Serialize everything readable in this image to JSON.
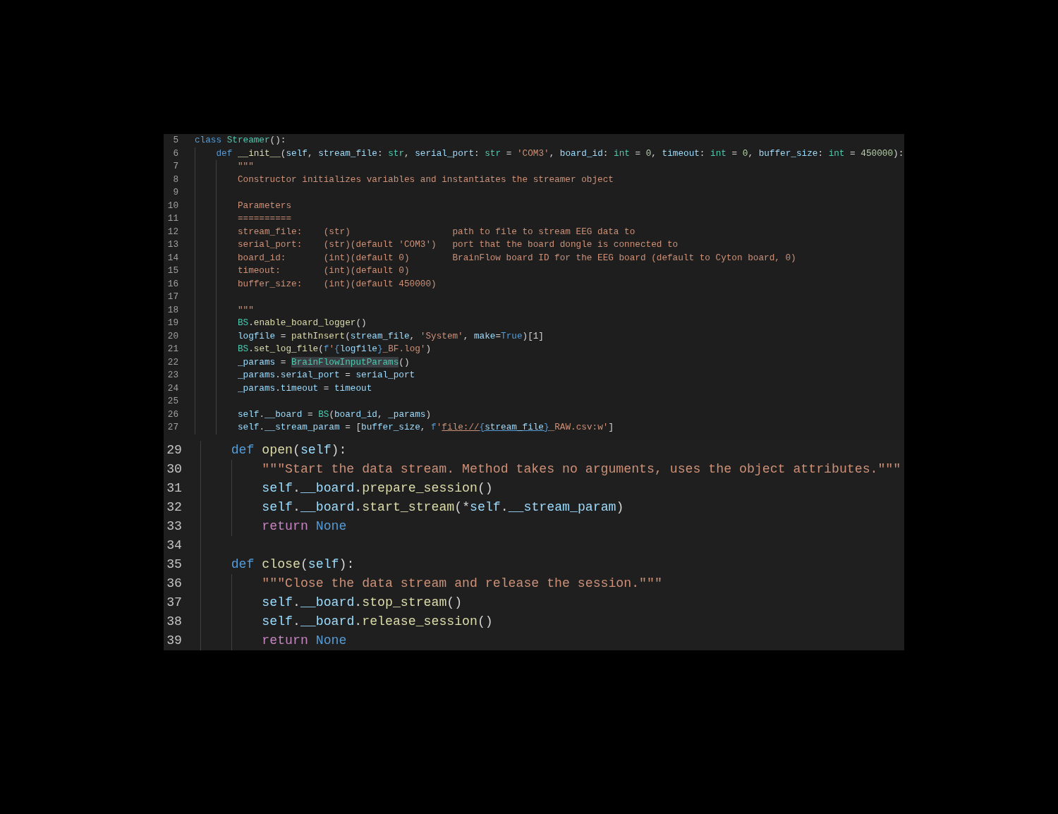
{
  "panels": [
    {
      "lines": [
        {
          "number": "5",
          "tokens": [
            {
              "text": "class ",
              "kind": "keyword"
            },
            {
              "text": "Streamer",
              "kind": "type"
            },
            {
              "text": "():",
              "kind": "plain"
            }
          ],
          "children": [
            {
              "number": "6",
              "tokens": [
                {
                  "text": "def ",
                  "kind": "keyword"
                },
                {
                  "text": "__init__",
                  "kind": "func"
                },
                {
                  "text": "(",
                  "kind": "plain"
                },
                {
                  "text": "self",
                  "kind": "var"
                },
                {
                  "text": ", ",
                  "kind": "plain"
                },
                {
                  "text": "stream_file",
                  "kind": "var"
                },
                {
                  "text": ": ",
                  "kind": "plain"
                },
                {
                  "text": "str",
                  "kind": "type"
                },
                {
                  "text": ", ",
                  "kind": "plain"
                },
                {
                  "text": "serial_port",
                  "kind": "var"
                },
                {
                  "text": ": ",
                  "kind": "plain"
                },
                {
                  "text": "str",
                  "kind": "type"
                },
                {
                  "text": " = ",
                  "kind": "plain"
                },
                {
                  "text": "'COM3'",
                  "kind": "string"
                },
                {
                  "text": ", ",
                  "kind": "plain"
                },
                {
                  "text": "board_id",
                  "kind": "var"
                },
                {
                  "text": ": ",
                  "kind": "plain"
                },
                {
                  "text": "int",
                  "kind": "type"
                },
                {
                  "text": " = ",
                  "kind": "plain"
                },
                {
                  "text": "0",
                  "kind": "number"
                },
                {
                  "text": ", ",
                  "kind": "plain"
                },
                {
                  "text": "timeout",
                  "kind": "var"
                },
                {
                  "text": ": ",
                  "kind": "plain"
                },
                {
                  "text": "int",
                  "kind": "type"
                },
                {
                  "text": " = ",
                  "kind": "plain"
                },
                {
                  "text": "0",
                  "kind": "number"
                },
                {
                  "text": ", ",
                  "kind": "plain"
                },
                {
                  "text": "buffer_size",
                  "kind": "var"
                },
                {
                  "text": ": ",
                  "kind": "plain"
                },
                {
                  "text": "int",
                  "kind": "type"
                },
                {
                  "text": " = ",
                  "kind": "plain"
                },
                {
                  "text": "450000",
                  "kind": "number"
                },
                {
                  "text": "):",
                  "kind": "plain"
                }
              ],
              "children": [
                {
                  "number": "7",
                  "tokens": [
                    {
                      "text": "\"\"\"",
                      "kind": "string"
                    }
                  ]
                },
                {
                  "number": "8",
                  "tokens": [
                    {
                      "text": "Constructor initializes variables and instantiates the streamer object",
                      "kind": "string"
                    }
                  ]
                },
                {
                  "number": "9"
                },
                {
                  "number": "10",
                  "tokens": [
                    {
                      "text": "Parameters",
                      "kind": "string"
                    }
                  ]
                },
                {
                  "number": "11",
                  "tokens": [
                    {
                      "text": "==========",
                      "kind": "string"
                    }
                  ]
                },
                {
                  "number": "12",
                  "tokens": [
                    {
                      "text": "stream_file:    (str)                   path to file to stream EEG data to",
                      "kind": "string"
                    }
                  ]
                },
                {
                  "number": "13",
                  "tokens": [
                    {
                      "text": "serial_port:    (str)(default 'COM3')   port that the board dongle is connected to",
                      "kind": "string"
                    }
                  ]
                },
                {
                  "number": "14",
                  "tokens": [
                    {
                      "text": "board_id:       (int)(default 0)        BrainFlow board ID for the EEG board (default to Cyton board, 0)",
                      "kind": "string"
                    }
                  ]
                },
                {
                  "number": "15",
                  "tokens": [
                    {
                      "text": "timeout:        (int)(default 0)",
                      "kind": "string"
                    }
                  ]
                },
                {
                  "number": "16",
                  "tokens": [
                    {
                      "text": "buffer_size:    (int)(default 450000)",
                      "kind": "string"
                    }
                  ]
                },
                {
                  "number": "17"
                },
                {
                  "number": "18",
                  "tokens": [
                    {
                      "text": "\"\"\"",
                      "kind": "string"
                    }
                  ]
                },
                {
                  "number": "19",
                  "tokens": [
                    {
                      "text": "BS",
                      "kind": "type"
                    },
                    {
                      "text": ".",
                      "kind": "plain"
                    },
                    {
                      "text": "enable_board_logger",
                      "kind": "func"
                    },
                    {
                      "text": "()",
                      "kind": "plain"
                    }
                  ]
                },
                {
                  "number": "20",
                  "tokens": [
                    {
                      "text": "logfile",
                      "kind": "var"
                    },
                    {
                      "text": " = ",
                      "kind": "plain"
                    },
                    {
                      "text": "pathInsert",
                      "kind": "func"
                    },
                    {
                      "text": "(",
                      "kind": "plain"
                    },
                    {
                      "text": "stream_file",
                      "kind": "var"
                    },
                    {
                      "text": ", ",
                      "kind": "plain"
                    },
                    {
                      "text": "'System'",
                      "kind": "string"
                    },
                    {
                      "text": ", ",
                      "kind": "plain"
                    },
                    {
                      "text": "make",
                      "kind": "var"
                    },
                    {
                      "text": "=",
                      "kind": "plain"
                    },
                    {
                      "text": "True",
                      "kind": "constant"
                    },
                    {
                      "text": ")[1]",
                      "kind": "plain"
                    }
                  ]
                },
                {
                  "number": "21",
                  "tokens": [
                    {
                      "text": "BS",
                      "kind": "type"
                    },
                    {
                      "text": ".",
                      "kind": "plain"
                    },
                    {
                      "text": "set_log_file",
                      "kind": "func"
                    },
                    {
                      "text": "(",
                      "kind": "plain"
                    },
                    {
                      "text": "f",
                      "kind": "constant"
                    },
                    {
                      "text": "'",
                      "kind": "string"
                    },
                    {
                      "text": "{",
                      "kind": "constant"
                    },
                    {
                      "text": "logfile",
                      "kind": "var"
                    },
                    {
                      "text": "}",
                      "kind": "constant"
                    },
                    {
                      "text": "_BF.log'",
                      "kind": "string"
                    },
                    {
                      "text": ")",
                      "kind": "plain"
                    }
                  ]
                },
                {
                  "number": "22",
                  "tokens": [
                    {
                      "text": "_params",
                      "kind": "var"
                    },
                    {
                      "text": " = ",
                      "kind": "plain"
                    },
                    {
                      "text": "BrainFlowInputParams",
                      "kind": "match"
                    },
                    {
                      "text": "()",
                      "kind": "plain"
                    }
                  ]
                },
                {
                  "number": "23",
                  "tokens": [
                    {
                      "text": "_params",
                      "kind": "var"
                    },
                    {
                      "text": ".",
                      "kind": "plain"
                    },
                    {
                      "text": "serial_port",
                      "kind": "var"
                    },
                    {
                      "text": " = ",
                      "kind": "plain"
                    },
                    {
                      "text": "serial_port",
                      "kind": "var"
                    }
                  ]
                },
                {
                  "number": "24",
                  "tokens": [
                    {
                      "text": "_params",
                      "kind": "var"
                    },
                    {
                      "text": ".",
                      "kind": "plain"
                    },
                    {
                      "text": "timeout",
                      "kind": "var"
                    },
                    {
                      "text": " = ",
                      "kind": "plain"
                    },
                    {
                      "text": "timeout",
                      "kind": "var"
                    }
                  ]
                },
                {
                  "number": "25"
                },
                {
                  "number": "26",
                  "tokens": [
                    {
                      "text": "self",
                      "kind": "var"
                    },
                    {
                      "text": ".",
                      "kind": "plain"
                    },
                    {
                      "text": "__board",
                      "kind": "var"
                    },
                    {
                      "text": " = ",
                      "kind": "plain"
                    },
                    {
                      "text": "BS",
                      "kind": "type"
                    },
                    {
                      "text": "(",
                      "kind": "plain"
                    },
                    {
                      "text": "board_id",
                      "kind": "var"
                    },
                    {
                      "text": ", ",
                      "kind": "plain"
                    },
                    {
                      "text": "_params",
                      "kind": "var"
                    },
                    {
                      "text": ")",
                      "kind": "plain"
                    }
                  ]
                },
                {
                  "number": "27",
                  "tokens": [
                    {
                      "text": "self",
                      "kind": "var"
                    },
                    {
                      "text": ".",
                      "kind": "plain"
                    },
                    {
                      "text": "__stream_param",
                      "kind": "var"
                    },
                    {
                      "text": " = [",
                      "kind": "plain"
                    },
                    {
                      "text": "buffer_size",
                      "kind": "var"
                    },
                    {
                      "text": ", ",
                      "kind": "plain"
                    },
                    {
                      "text": "f",
                      "kind": "constant"
                    },
                    {
                      "text": "'",
                      "kind": "string"
                    },
                    {
                      "text": "file://",
                      "kind": "link"
                    },
                    {
                      "text": "{",
                      "kind": "linkbrace"
                    },
                    {
                      "text": "stream_file",
                      "kind": "linkvar"
                    },
                    {
                      "text": "}",
                      "kind": "linkbrace"
                    },
                    {
                      "text": "_RAW.csv:w'",
                      "kind": "string"
                    },
                    {
                      "text": "]",
                      "kind": "plain"
                    }
                  ]
                }
              ]
            }
          ]
        }
      ]
    },
    {
      "lines": [
        {
          "number": "29",
          "tokens": [
            {
              "text": "def ",
              "kind": "keyword"
            },
            {
              "text": "open",
              "kind": "func"
            },
            {
              "text": "(",
              "kind": "plain"
            },
            {
              "text": "self",
              "kind": "var"
            },
            {
              "text": "):",
              "kind": "plain"
            }
          ],
          "children": [
            {
              "number": "30",
              "tokens": [
                {
                  "text": "\"\"\"Start the data stream. Method takes no arguments, uses the object attributes.\"\"\"",
                  "kind": "string"
                }
              ]
            },
            {
              "number": "31",
              "tokens": [
                {
                  "text": "self",
                  "kind": "var"
                },
                {
                  "text": ".",
                  "kind": "plain"
                },
                {
                  "text": "__board",
                  "kind": "var"
                },
                {
                  "text": ".",
                  "kind": "plain"
                },
                {
                  "text": "prepare_session",
                  "kind": "func"
                },
                {
                  "text": "()",
                  "kind": "plain"
                }
              ]
            },
            {
              "number": "32",
              "tokens": [
                {
                  "text": "self",
                  "kind": "var"
                },
                {
                  "text": ".",
                  "kind": "plain"
                },
                {
                  "text": "__board",
                  "kind": "var"
                },
                {
                  "text": ".",
                  "kind": "plain"
                },
                {
                  "text": "start_stream",
                  "kind": "func"
                },
                {
                  "text": "(*",
                  "kind": "plain"
                },
                {
                  "text": "self",
                  "kind": "var"
                },
                {
                  "text": ".",
                  "kind": "plain"
                },
                {
                  "text": "__stream_param",
                  "kind": "var"
                },
                {
                  "text": ")",
                  "kind": "plain"
                }
              ]
            },
            {
              "number": "33",
              "tokens": [
                {
                  "text": "return ",
                  "kind": "control"
                },
                {
                  "text": "None",
                  "kind": "constant"
                }
              ]
            }
          ]
        },
        {
          "number": "34"
        },
        {
          "number": "35",
          "tokens": [
            {
              "text": "def ",
              "kind": "keyword"
            },
            {
              "text": "close",
              "kind": "func"
            },
            {
              "text": "(",
              "kind": "plain"
            },
            {
              "text": "self",
              "kind": "var"
            },
            {
              "text": "):",
              "kind": "plain"
            }
          ],
          "children": [
            {
              "number": "36",
              "tokens": [
                {
                  "text": "\"\"\"Close the data stream and release the session.\"\"\"",
                  "kind": "string"
                }
              ]
            },
            {
              "number": "37",
              "tokens": [
                {
                  "text": "self",
                  "kind": "var"
                },
                {
                  "text": ".",
                  "kind": "plain"
                },
                {
                  "text": "__board",
                  "kind": "var"
                },
                {
                  "text": ".",
                  "kind": "plain"
                },
                {
                  "text": "stop_stream",
                  "kind": "func"
                },
                {
                  "text": "()",
                  "kind": "plain"
                }
              ]
            },
            {
              "number": "38",
              "tokens": [
                {
                  "text": "self",
                  "kind": "var"
                },
                {
                  "text": ".",
                  "kind": "plain"
                },
                {
                  "text": "__board",
                  "kind": "var"
                },
                {
                  "text": ".",
                  "kind": "plain"
                },
                {
                  "text": "release_session",
                  "kind": "func"
                },
                {
                  "text": "()",
                  "kind": "plain"
                }
              ]
            },
            {
              "number": "39",
              "tokens": [
                {
                  "text": "return ",
                  "kind": "control"
                },
                {
                  "text": "None",
                  "kind": "constant"
                }
              ]
            }
          ]
        }
      ]
    }
  ]
}
